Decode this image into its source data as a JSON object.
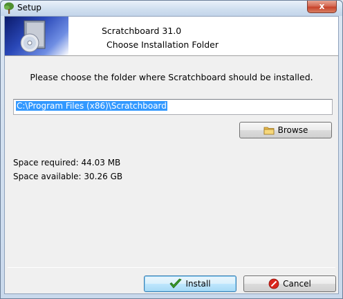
{
  "window": {
    "title": "Setup",
    "close_glyph": "x"
  },
  "header": {
    "product": "Scratchboard 31.0",
    "subtitle": "Choose Installation Folder",
    "graphic_icon": "installer-disc-icon"
  },
  "main": {
    "instruction": "Please choose the folder where Scratchboard should be installed.",
    "install_path": "C:\\Program Files (x86)\\Scratchboard",
    "browse_label": "Browse",
    "space_required": "Space required: 44.03 MB",
    "space_available": "Space available: 30.26 GB"
  },
  "footer": {
    "install_label": "Install",
    "cancel_label": "Cancel"
  },
  "colors": {
    "selection": "#3399ff",
    "install_check": "#3a9a2a",
    "cancel_icon": "#d9261c"
  }
}
